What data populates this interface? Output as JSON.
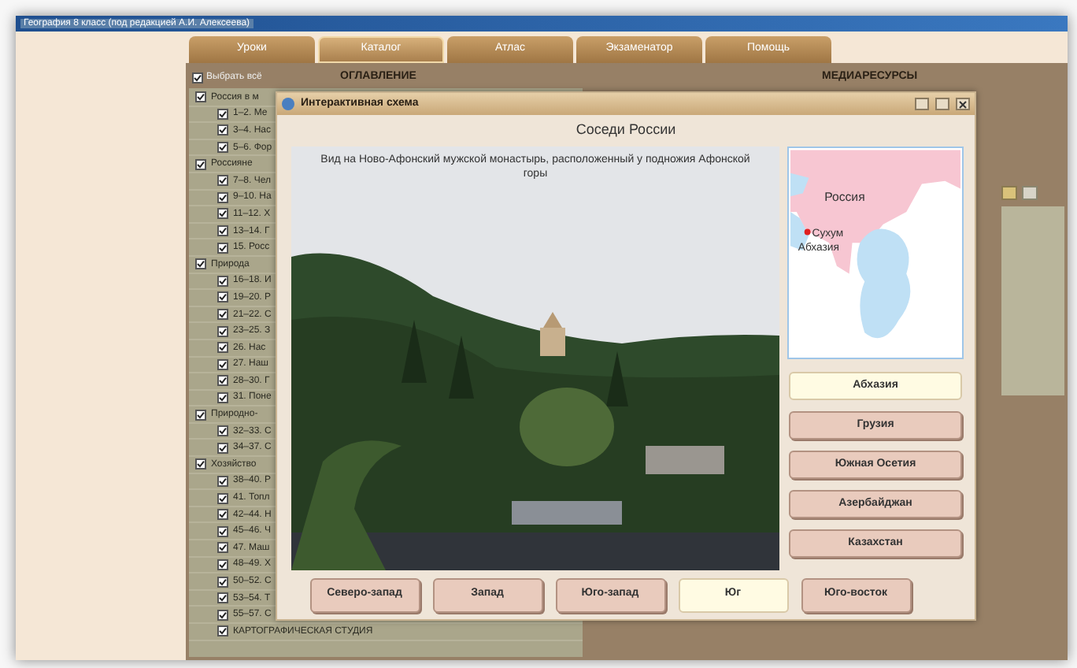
{
  "app": {
    "title": "География 8 класс (под редакцией А.И. Алексеева)"
  },
  "tabs": [
    {
      "label": "Уроки",
      "selected": false
    },
    {
      "label": "Каталог",
      "selected": true
    },
    {
      "label": "Атлас",
      "selected": false
    },
    {
      "label": "Экзаменатор",
      "selected": false
    },
    {
      "label": "Помощь",
      "selected": false
    }
  ],
  "catalog": {
    "select_all": {
      "label": "Выбрать всё",
      "checked": true
    },
    "heading": "ОГЛАВЛЕНИЕ",
    "media_heading": "МЕДИАРЕСУРСЫ",
    "tree": [
      {
        "label": "Россия в м",
        "checked": true,
        "children": [
          {
            "label": "1–2. Ме",
            "checked": true
          },
          {
            "label": "3–4. Нас",
            "checked": true
          },
          {
            "label": "5–6. Фор",
            "checked": true
          }
        ]
      },
      {
        "label": "Россияне",
        "checked": true,
        "children": [
          {
            "label": "7–8. Чел",
            "checked": true
          },
          {
            "label": "9–10. На",
            "checked": true
          },
          {
            "label": "11–12. Х",
            "checked": true
          },
          {
            "label": "13–14. Г",
            "checked": true
          },
          {
            "label": "15. Росс",
            "checked": true
          }
        ]
      },
      {
        "label": "Природа",
        "checked": true,
        "children": [
          {
            "label": "16–18. И",
            "checked": true
          },
          {
            "label": "19–20. Р",
            "checked": true
          },
          {
            "label": "21–22. С",
            "checked": true
          },
          {
            "label": "23–25. З",
            "checked": true
          },
          {
            "label": "26. Нас",
            "checked": true
          },
          {
            "label": "27. Наш",
            "checked": true
          },
          {
            "label": "28–30. Г",
            "checked": true
          },
          {
            "label": "31. Поне",
            "checked": true
          }
        ]
      },
      {
        "label": "Природно-",
        "checked": true,
        "children": [
          {
            "label": "32–33. С",
            "checked": true
          },
          {
            "label": "34–37. С",
            "checked": true
          }
        ]
      },
      {
        "label": "Хозяйство",
        "checked": true,
        "children": [
          {
            "label": "38–40. Р",
            "checked": true
          },
          {
            "label": "41. Топл",
            "checked": true
          },
          {
            "label": "42–44. Н",
            "checked": true
          },
          {
            "label": "45–46. Ч",
            "checked": true
          },
          {
            "label": "47. Маш",
            "checked": true
          },
          {
            "label": "48–49. Х",
            "checked": true
          },
          {
            "label": "50–52. С",
            "checked": true
          },
          {
            "label": "53–54. Т",
            "checked": true
          },
          {
            "label": "55–57. С",
            "checked": true
          },
          {
            "label": "КАРТОГРАФИЧЕСКАЯ СТУДИЯ",
            "checked": true
          }
        ]
      }
    ]
  },
  "dialog": {
    "title": "Интерактивная схема",
    "heading": "Соседи России",
    "photo": {
      "kind": "picture",
      "caption": "Вид на Ново-Афонский мужской монастырь, расположенный у подножия Афонской горы"
    },
    "map_labels": [
      "Россия",
      "Сухум",
      "Абхазия"
    ],
    "countries": [
      {
        "label": "Абхазия",
        "selected": true
      },
      {
        "label": "Грузия",
        "selected": false
      },
      {
        "label": "Южная Осетия",
        "selected": false
      },
      {
        "label": "Азербайджан",
        "selected": false
      },
      {
        "label": "Казахстан",
        "selected": false
      }
    ],
    "directions": [
      {
        "label": "Северо-запад",
        "selected": false
      },
      {
        "label": "Запад",
        "selected": false
      },
      {
        "label": "Юго-запад",
        "selected": false
      },
      {
        "label": "Юг",
        "selected": true
      },
      {
        "label": "Юго-восток",
        "selected": false
      }
    ]
  }
}
